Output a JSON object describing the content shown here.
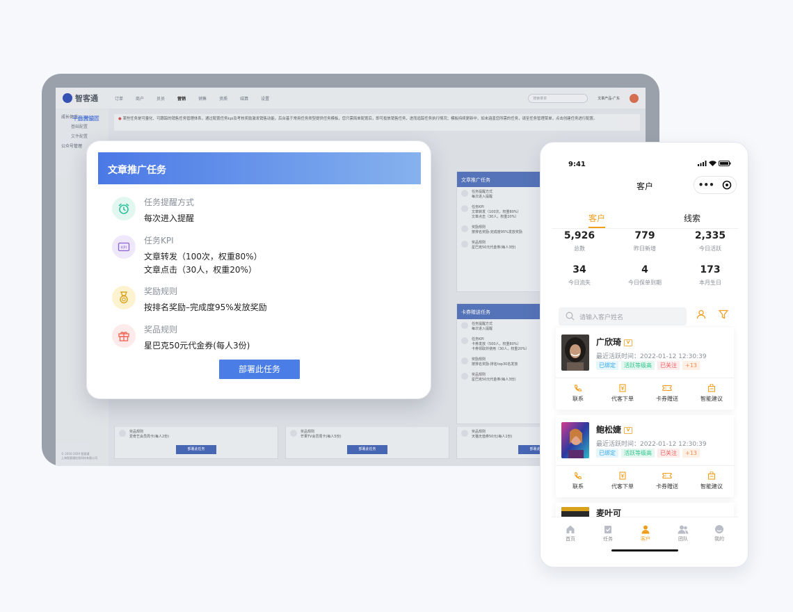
{
  "desktop": {
    "logo": "智客通",
    "nav": [
      "订单",
      "商户",
      "员员",
      "营销",
      "销售",
      "资质",
      "结算",
      "设置"
    ],
    "nav_active": 3,
    "search_placeholder": "搜索菜单",
    "user": "文章产品-广东",
    "sidebar": [
      "成长体系",
      "平台营销",
      "基础配置",
      "页面设置",
      "文件配置",
      "公众号管理"
    ],
    "notice": "某些任务是可量化、可跟踪的销售任务管理体系，通过配置任务kpi及考核奖励激发销售动能，后台基于常用任务类型提供任务模板，您只需简单配置后，即可投放销售任务，进而追踪任务执行情况；模板持续更新中，如未涵盖您所需的任务，请至任务管理菜单，点击创建任务进行配置。",
    "cards": [
      {
        "title": "文章推广任务",
        "rows": [
          "任务提醒方式",
          "每次进入提醒",
          "任务KPI",
          "文章转发（100次，权重80%）",
          "文章点击（30人，权重20%）",
          "奖励规则",
          "按排名奖励-完成度95%发放奖励",
          "奖品规则",
          "星巴克50元代金券(每人3份)"
        ]
      },
      {
        "title": "卡券赠送任务",
        "rows": [
          "任务提醒方式",
          "每次进入提醒",
          "任务KPI",
          "卡券发放（500人，权重80%）",
          "卡券领取并使用（30人，权重20%）",
          "奖励规则",
          "按排名奖励-排名top30名发放",
          "奖品规则",
          "星巴克50元代金券(每人3份)"
        ]
      }
    ],
    "bottom_cards": [
      {
        "prize_label": "奖品规则",
        "prize": "爱奇艺会员周卡(每人2份)",
        "button": "部署此任务"
      },
      {
        "prize_label": "奖品规则",
        "prize": "芒果TV会员周卡(每人5份)",
        "button": "部署此任务"
      },
      {
        "prize_label": "奖品规则",
        "prize": "天猫无值券50元(每人1份)",
        "button": "部署此任务"
      }
    ],
    "footer": [
      "© 2016-2020 智客通",
      "上海智客通信息科技有限公司"
    ]
  },
  "modal": {
    "title": "文章推广任务",
    "sections": [
      {
        "label": "任务提醒方式",
        "values": [
          "每次进入提醒"
        ]
      },
      {
        "label": "任务KPI",
        "values": [
          "文章转发（100次，权重80%）",
          "文章点击（30人，权重20%）"
        ]
      },
      {
        "label": "奖励规则",
        "values": [
          "按排名奖励–完成度95%发放奖励"
        ]
      },
      {
        "label": "奖品规则",
        "values": [
          "星巴克50元代金券(每人3份)"
        ]
      }
    ],
    "kpi_icon_text": "KPI",
    "button": "部署此任务"
  },
  "phone": {
    "time": "9:41",
    "title": "客户",
    "tabs": [
      "客户",
      "线索"
    ],
    "stats": [
      {
        "value": "5,926",
        "label": "总数"
      },
      {
        "value": "779",
        "label": "昨日新增"
      },
      {
        "value": "2,335",
        "label": "今日活跃"
      },
      {
        "value": "34",
        "label": "今日流失"
      },
      {
        "value": "4",
        "label": "今日保单到期"
      },
      {
        "value": "173",
        "label": "本月生日"
      }
    ],
    "search_placeholder": "请输入客户姓名",
    "customers": [
      {
        "name": "广欣琦",
        "badge": "V",
        "date": "最近活跃时间：2022-01-12 12:30:39",
        "tags": [
          "已绑定",
          "活跃等级高",
          "已关注",
          "+13"
        ]
      },
      {
        "name": "鲍松婕",
        "badge": "V",
        "date": "最近活跃时间：2022-01-12 12:30:39",
        "tags": [
          "已绑定",
          "活跃等级高",
          "已关注",
          "+13"
        ]
      },
      {
        "name": "麦叶可"
      }
    ],
    "actions": [
      "联系",
      "代客下单",
      "卡券赠送",
      "智能建议"
    ],
    "tabbar": [
      "首页",
      "任务",
      "客户",
      "团队",
      "我的"
    ],
    "tabbar_active": 2,
    "colors": {
      "accent": "#f09e1c",
      "primary": "#4a7ee6"
    }
  }
}
